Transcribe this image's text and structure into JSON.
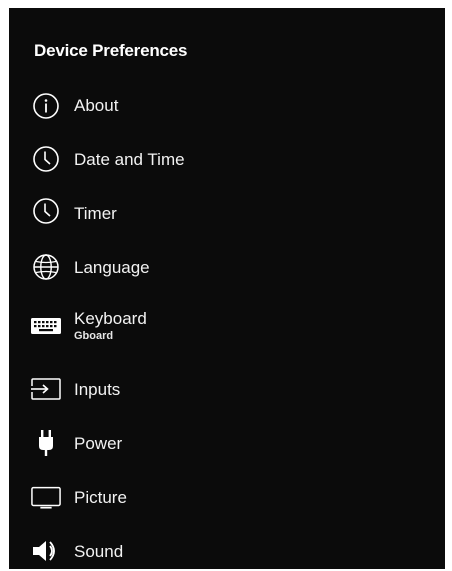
{
  "header": {
    "title": "Device Preferences"
  },
  "items": [
    {
      "label": "About",
      "icon": "info-icon"
    },
    {
      "label": "Date and Time",
      "icon": "clock-icon"
    },
    {
      "label": "Timer",
      "icon": "clock-icon"
    },
    {
      "label": "Language",
      "icon": "globe-icon"
    },
    {
      "label": "Keyboard",
      "subtitle": "Gboard",
      "icon": "keyboard-icon"
    },
    {
      "label": "Inputs",
      "icon": "input-icon"
    },
    {
      "label": "Power",
      "icon": "plug-icon"
    },
    {
      "label": "Picture",
      "icon": "tv-icon"
    },
    {
      "label": "Sound",
      "icon": "speaker-icon"
    }
  ],
  "colors": {
    "background": "#0b0b0b",
    "text": "#ffffff"
  }
}
